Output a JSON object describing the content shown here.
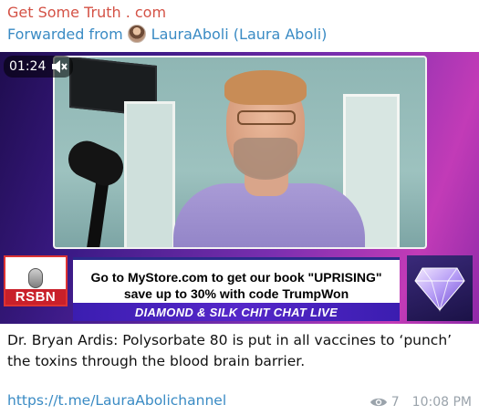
{
  "message": {
    "channel_name": "Get Some Truth . com",
    "forwarded_prefix": "Forwarded from",
    "forwarded_from": "LauraAboli (Laura Aboli)",
    "video": {
      "duration": "01:24",
      "muted": true,
      "banner": {
        "logo_text": "RSBN",
        "ad_line_1": "Go to MyStore.com to get our book \"UPRISING\"",
        "ad_line_2": "save up to 30% with code TrumpWon",
        "show_title": "DIAMOND & SILK CHIT CHAT LIVE"
      }
    },
    "caption": "Dr. Bryan Ardis: Polysorbate 80 is put in all vaccines to ‘punch’ the toxins through the blood brain barrier.",
    "link": "https://t.me/LauraAbolichannel",
    "views": "7",
    "time": "10:08 PM"
  },
  "colors": {
    "channel_name": "#d45246",
    "link": "#3a8bc4",
    "meta": "#9aa3ab"
  },
  "icons": {
    "mute": "speaker-muted-icon",
    "views": "eye-icon",
    "forward_avatar": "avatar"
  }
}
